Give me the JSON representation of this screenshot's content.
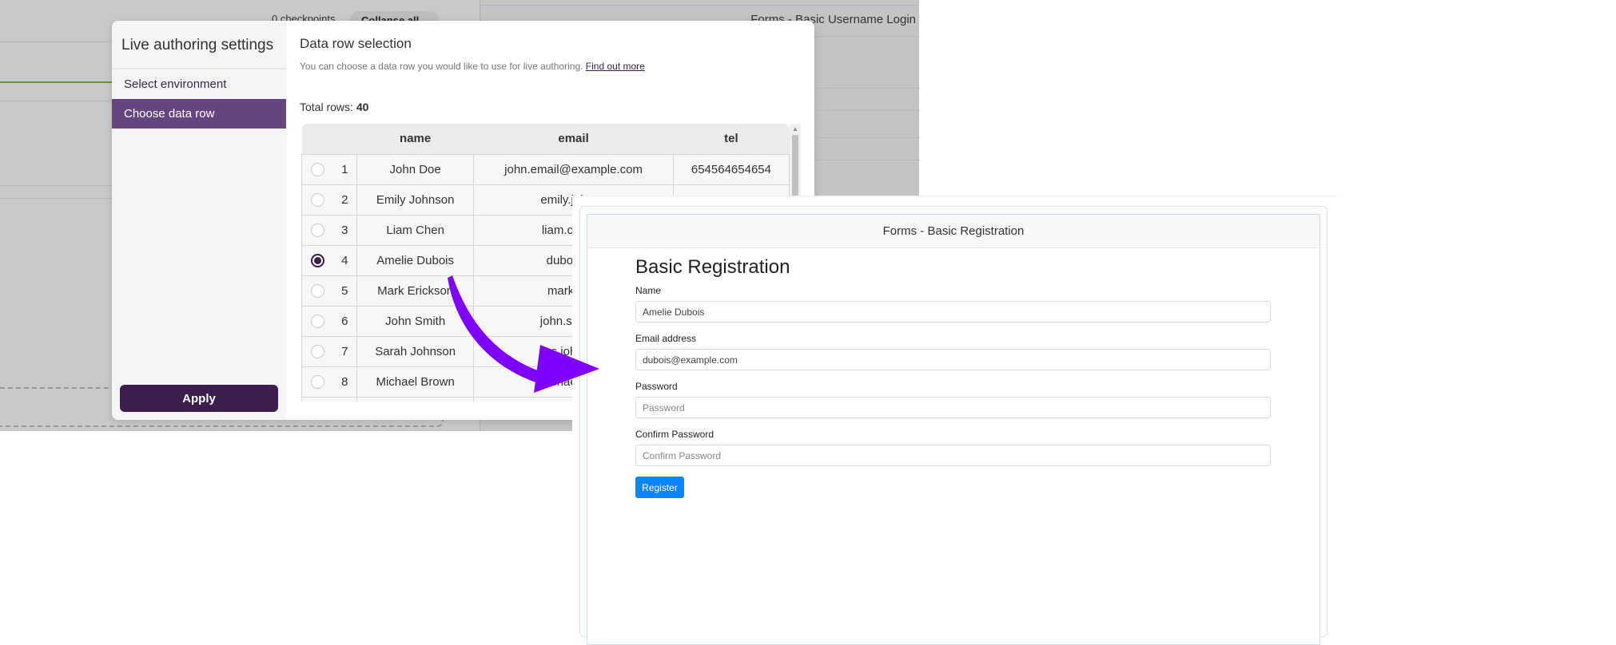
{
  "background": {
    "checkpoints": "0 checkpoints",
    "collapse_all": "Collapse all",
    "page_header": "Forms - Basic Username Login"
  },
  "modal": {
    "sidebar_title": "Live authoring settings",
    "sidebar_items": [
      {
        "label": "Select environment",
        "active": false
      },
      {
        "label": "Choose data row",
        "active": true
      }
    ],
    "apply_label": "Apply",
    "title": "Data row selection",
    "subtitle": "You can choose a data row you would like to use for live authoring.",
    "find_out_more": "Find out more",
    "total_rows_label": "Total rows:",
    "total_rows": "40",
    "columns": [
      "name",
      "email",
      "tel"
    ],
    "rows": [
      {
        "n": "1",
        "name": "John Doe",
        "email": "john.email@example.com",
        "tel": "654564654654",
        "selected": false
      },
      {
        "n": "2",
        "name": "Emily Johnson",
        "email": "emily.johnso",
        "tel": "",
        "selected": false
      },
      {
        "n": "3",
        "name": "Liam Chen",
        "email": "liam.chen@",
        "tel": "",
        "selected": false
      },
      {
        "n": "4",
        "name": "Amelie Dubois",
        "email": "dubois@e",
        "tel": "",
        "selected": true
      },
      {
        "n": "5",
        "name": "Mark Erickson",
        "email": "mark_e@",
        "tel": "",
        "selected": false
      },
      {
        "n": "6",
        "name": "John Smith",
        "email": "john.smith@",
        "tel": "",
        "selected": false
      },
      {
        "n": "7",
        "name": "Sarah Johnson",
        "email": "s.johnso",
        "tel": "",
        "selected": false
      },
      {
        "n": "8",
        "name": "Michael Brown",
        "email": "michael.brow",
        "tel": "",
        "selected": false
      }
    ]
  },
  "arrow_color": "#7f00ff",
  "registration": {
    "header": "Forms - Basic Registration",
    "heading": "Basic Registration",
    "name_label": "Name",
    "name_value": "Amelie Dubois",
    "email_label": "Email address",
    "email_value": "dubois@example.com",
    "password_label": "Password",
    "password_placeholder": "Password",
    "confirm_label": "Confirm Password",
    "confirm_placeholder": "Confirm Password",
    "register_label": "Register"
  }
}
